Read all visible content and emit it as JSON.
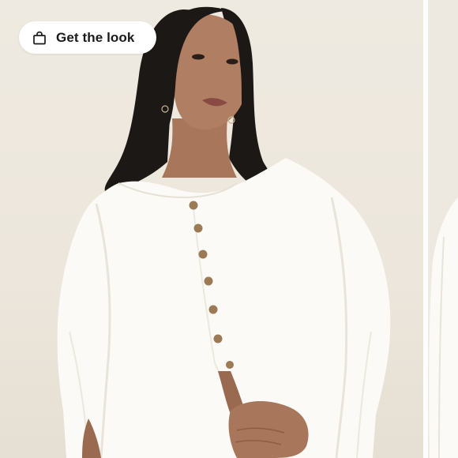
{
  "shop_the_look": {
    "label": "Get the look",
    "icon": "shopping-bag-icon"
  },
  "product_image": {
    "subject": "model-wearing-white-linen-button-front-top",
    "garment_color": "#fbfaf6",
    "button_color": "#9c7a55",
    "hair_color": "#1c1816",
    "skin_color": "#a8765a",
    "background_color": "#ede8df"
  }
}
